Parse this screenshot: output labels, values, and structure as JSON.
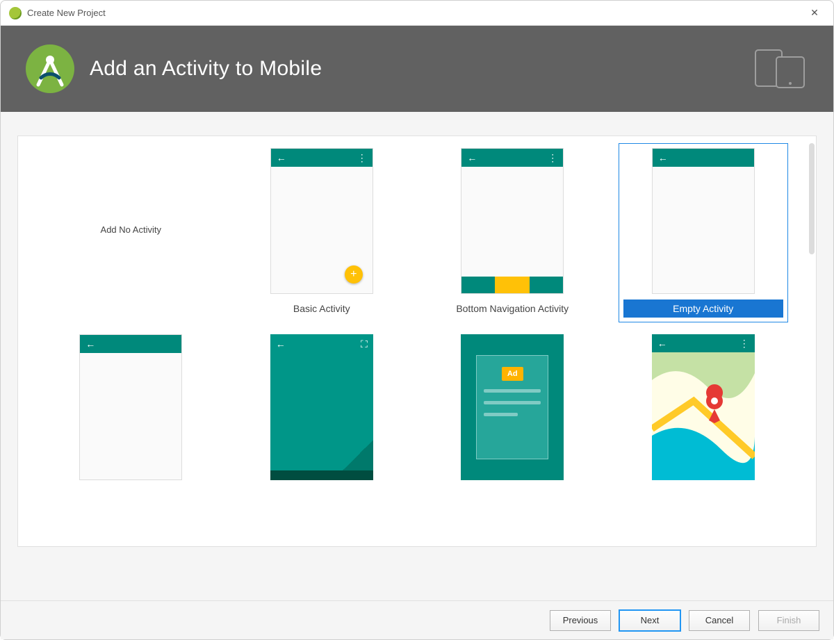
{
  "window": {
    "title": "Create New Project"
  },
  "header": {
    "title": "Add an Activity to Mobile"
  },
  "templates": {
    "row1": [
      {
        "id": "no-activity",
        "label": "Add No Activity",
        "selected": false
      },
      {
        "id": "basic",
        "label": "Basic Activity",
        "selected": false
      },
      {
        "id": "bottom-nav",
        "label": "Bottom Navigation Activity",
        "selected": false
      },
      {
        "id": "empty",
        "label": "Empty Activity",
        "selected": true
      }
    ],
    "ad_badge": "Ad"
  },
  "footer": {
    "previous": "Previous",
    "next": "Next",
    "cancel": "Cancel",
    "finish": "Finish"
  },
  "colors": {
    "accent_teal": "#00897b",
    "accent_amber": "#ffc107",
    "selection_blue": "#1976d2",
    "banner_grey": "#616161"
  }
}
